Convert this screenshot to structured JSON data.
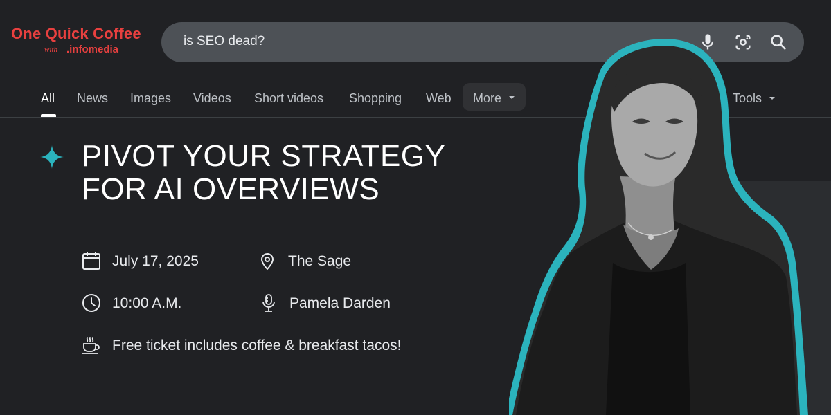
{
  "logo": {
    "title": "One Quick Coffee",
    "with": "with",
    "brand": ".infomedia"
  },
  "search": {
    "query": "is SEO dead?",
    "icons": [
      "microphone-icon",
      "camera-lens-icon",
      "search-icon"
    ]
  },
  "tabs": {
    "items": [
      {
        "label": "All",
        "active": true
      },
      {
        "label": "News"
      },
      {
        "label": "Images"
      },
      {
        "label": "Videos"
      },
      {
        "label": "Short videos"
      },
      {
        "label": "Shopping"
      },
      {
        "label": "Web"
      },
      {
        "label": "More"
      }
    ],
    "tools": "Tools"
  },
  "event": {
    "headline_line1": "PIVOT YOUR STRATEGY",
    "headline_line2": "FOR AI OVERVIEWS",
    "date": "July 17, 2025",
    "time": "10:00 A.M.",
    "location": "The Sage",
    "speaker": "Pamela Darden",
    "perk": "Free ticket includes coffee & breakfast tacos!"
  },
  "colors": {
    "accent_teal": "#2bb3bd",
    "logo_red": "#e8403f",
    "background": "#202124",
    "search_bar": "#4d5156"
  }
}
